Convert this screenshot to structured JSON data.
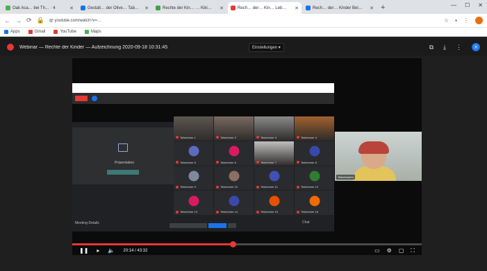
{
  "browser": {
    "tabs": [
      {
        "label": "Oak Aca… bei Th… · 4",
        "color": "#4caf50",
        "active": false
      },
      {
        "label": "Gestalt… der Olive… Tab…",
        "color": "#1a73e8",
        "active": false
      },
      {
        "label": "Rechte der Kin… … Kiki…",
        "color": "#43a047",
        "active": false
      },
      {
        "label": "Rech… der… Kin… Leb…",
        "color": "#e53935",
        "active": true
      },
      {
        "label": "Rech… der… Kinder Bel…",
        "color": "#1a73e8",
        "active": false
      }
    ],
    "new_tab": "+",
    "url": "@ youtube.com/watch?v=…",
    "bookmarks": [
      {
        "label": "Apps",
        "color": "#1a73e8"
      },
      {
        "label": "Gmail",
        "color": "#e53935"
      },
      {
        "label": "YouTube",
        "color": "#e53935"
      },
      {
        "label": "Maps",
        "color": "#4caf50"
      }
    ]
  },
  "video": {
    "title": "Webinar — Rechte der Kinder — Aufzeichnung 2020-09-18 10:31:45",
    "quality": "Einstellungen ▾",
    "share_label": "Präsentation",
    "bottom_left": "Meeting-Details",
    "bottom_right": "Chat",
    "webcam_name": "Teilnehmerin",
    "progress": 0.46,
    "time": "20:14 / 43:32"
  },
  "participants": [
    {
      "kind": "photo",
      "name": "Teilnehmer 1",
      "color": "#5c5752"
    },
    {
      "kind": "photo",
      "name": "Teilnehmer 2",
      "color": "#7a6a62"
    },
    {
      "kind": "photo",
      "name": "Teilnehmer 3",
      "color": "#8a8a8a"
    },
    {
      "kind": "photo",
      "name": "Teilnehmer 4",
      "color": "#a0622e"
    },
    {
      "kind": "avatar",
      "name": "Teilnehmer 5",
      "color": "#5c6bc0"
    },
    {
      "kind": "avatar",
      "name": "Teilnehmer 6",
      "color": "#d81b60"
    },
    {
      "kind": "photo",
      "name": "Teilnehmer 7",
      "color": "#bfbfbf"
    },
    {
      "kind": "avatar",
      "name": "Teilnehmer 8",
      "color": "#3949ab"
    },
    {
      "kind": "avatar",
      "name": "Teilnehmer 9",
      "color": "#7e8a9a"
    },
    {
      "kind": "avatar",
      "name": "Teilnehmer 10",
      "color": "#8d6e63"
    },
    {
      "kind": "avatar",
      "name": "Teilnehmer 11",
      "color": "#3f51b5"
    },
    {
      "kind": "avatar",
      "name": "Teilnehmer 12",
      "color": "#2e7d32"
    },
    {
      "kind": "avatar",
      "name": "Teilnehmer 13",
      "color": "#d81b60"
    },
    {
      "kind": "avatar",
      "name": "Teilnehmer 14",
      "color": "#3949ab"
    },
    {
      "kind": "avatar",
      "name": "Teilnehmer 15",
      "color": "#e65100"
    },
    {
      "kind": "avatar",
      "name": "Teilnehmer 16",
      "color": "#ef6c00"
    }
  ],
  "colors": {
    "accent_red": "#e53935",
    "accent_blue": "#1a73e8"
  }
}
